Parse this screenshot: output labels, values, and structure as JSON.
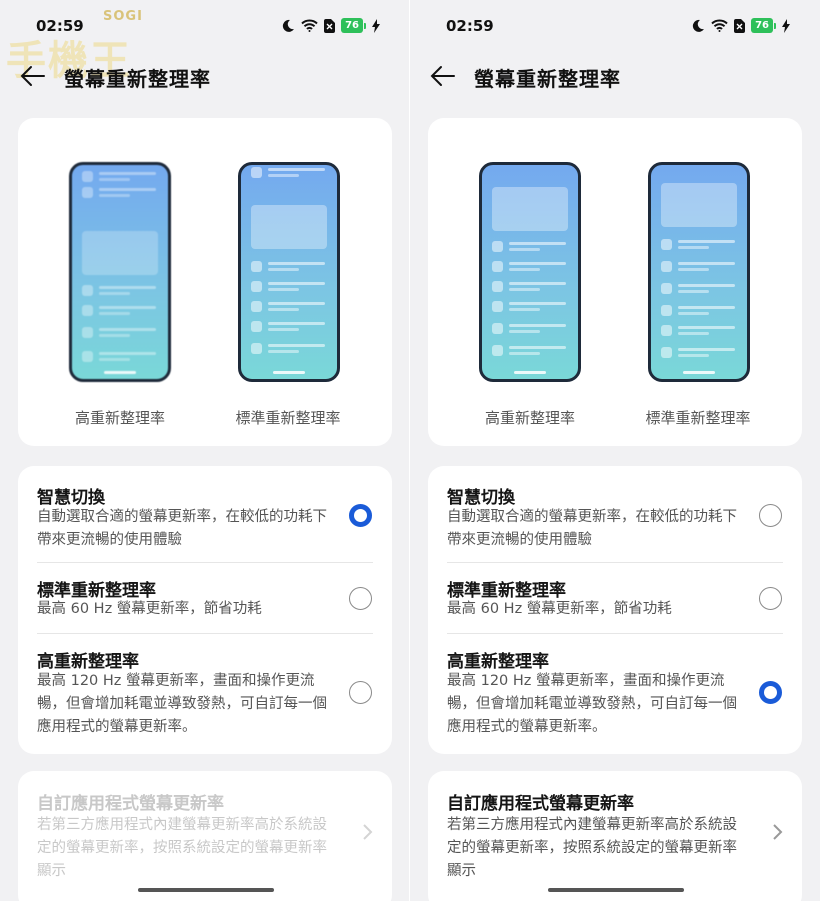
{
  "status": {
    "time": "02:59",
    "battery": "76"
  },
  "header": {
    "title": "螢幕重新整理率"
  },
  "watermark": {
    "brand": "SOGI",
    "text": "手機王"
  },
  "preview": {
    "high_label": "高重新整理率",
    "standard_label": "標準重新整理率"
  },
  "options": [
    {
      "name": "智慧切換",
      "desc": "自動選取合適的螢幕更新率，在較低的功耗下帶來更流暢的使用體驗"
    },
    {
      "name": "標準重新整理率",
      "desc": "最高 60 Hz 螢幕更新率，節省功耗"
    },
    {
      "name": "高重新整理率",
      "desc": "最高 120 Hz 螢幕更新率，畫面和操作更流暢，但會增加耗電並導致發熱，可自訂每一個應用程式的螢幕更新率。"
    }
  ],
  "custom": {
    "name": "自訂應用程式螢幕更新率",
    "desc": "若第三方應用程式內建螢幕更新率高於系統設定的螢幕更新率，按照系統設定的螢幕更新率顯示"
  },
  "screens": [
    {
      "selected_option": "智慧切換",
      "custom_enabled": false
    },
    {
      "selected_option": "高重新整理率",
      "custom_enabled": true
    }
  ],
  "colors": {
    "accent": "#1a5bd8",
    "battery": "#2ec05a",
    "background": "#f1f1f3"
  }
}
